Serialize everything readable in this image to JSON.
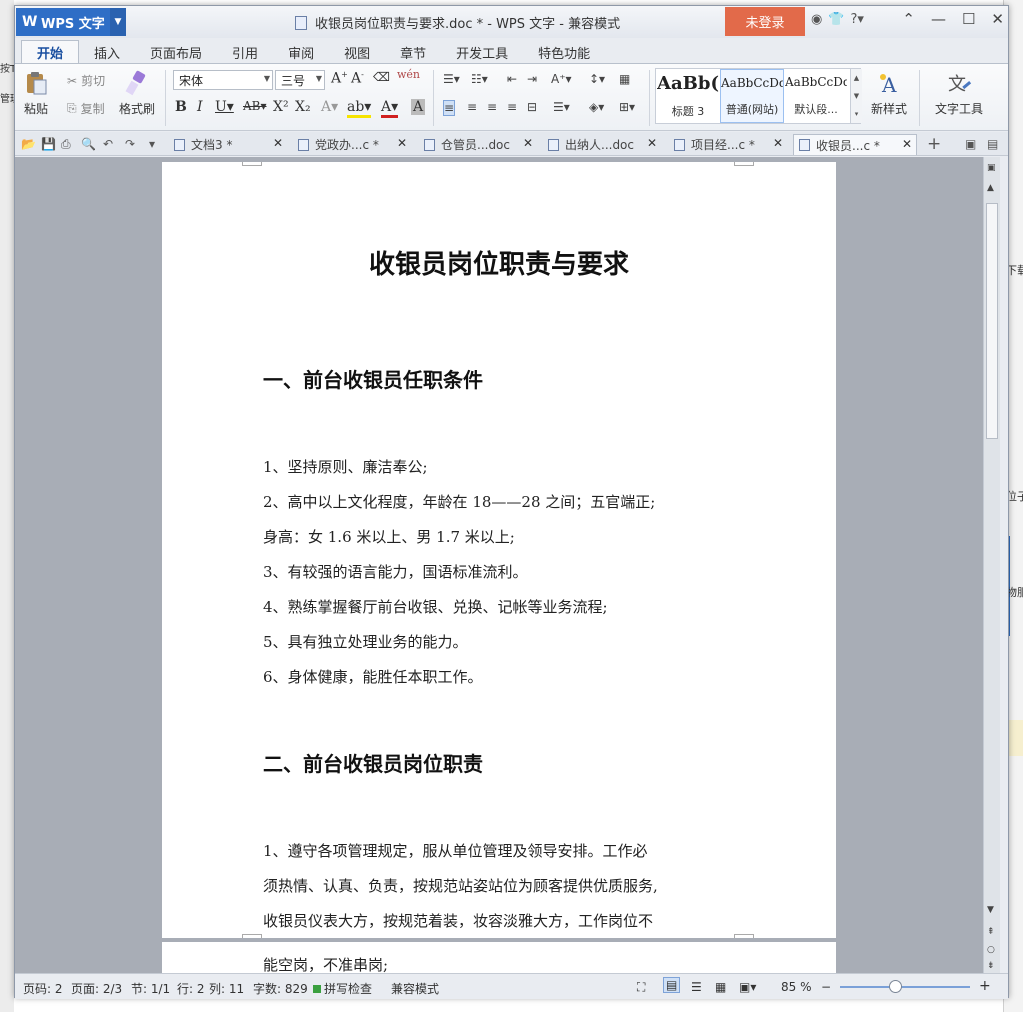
{
  "app": {
    "name": "WPS 文字",
    "window_title": "收银员岗位职责与要求.doc * - WPS 文字 - 兼容模式",
    "login_label": "未登录"
  },
  "ribbon_tabs": [
    "开始",
    "插入",
    "页面布局",
    "引用",
    "审阅",
    "视图",
    "章节",
    "开发工具",
    "特色功能"
  ],
  "ribbon": {
    "paste": "粘贴",
    "cut": "剪切",
    "copy": "复制",
    "format_painter": "格式刷",
    "font_name": "宋体",
    "font_size": "三号",
    "new_style": "新样式",
    "text_tools": "文字工具",
    "styles": [
      {
        "preview": "AaBb(",
        "name": "标题 3"
      },
      {
        "preview": "AaBbCcDd",
        "name": "普通(网站)"
      },
      {
        "preview": "AaBbCcDd",
        "name": "默认段..."
      }
    ]
  },
  "doc_tabs": [
    {
      "label": "文档3 *"
    },
    {
      "label": "党政办...c *"
    },
    {
      "label": "仓管员...doc"
    },
    {
      "label": "出纳人...doc"
    },
    {
      "label": "项目经...c *"
    },
    {
      "label": "收银员...c *"
    }
  ],
  "document": {
    "title": "收银员岗位职责与要求",
    "section1_heading": "一、前台收银员任职条件",
    "section1_items": [
      "1、坚持原则、廉洁奉公;",
      "2、高中以上文化程度，年龄在 18——28 之间；五官端正;",
      "身高：女 1.6 米以上、男 1.7 米以上;",
      "3、有较强的语言能力，国语标准流利。",
      "4、熟练掌握餐厅前台收银、兑换、记帐等业务流程;",
      "5、具有独立处理业务的能力。",
      "6、身体健康，能胜任本职工作。"
    ],
    "section2_heading": "二、前台收银员岗位职责",
    "section2_lines": [
      "1、遵守各项管理规定，服从单位管理及领导安排。工作必",
      "须热情、认真、负责，按规范站姿站位为顾客提供优质服务,",
      "收银员仪表大方，按规范着装，妆容淡雅大方，工作岗位不"
    ],
    "page2_line": "能空岗，不准串岗;"
  },
  "status": {
    "page": "页码: 2",
    "pages": "页面: 2/3",
    "section": "节: 1/1",
    "row": "行: 2",
    "col": "列: 11",
    "word_count": "字数: 829",
    "spell_check": "拼写检查",
    "compat": "兼容模式",
    "zoom": "85 %"
  },
  "desktop_right_texts": [
    "下载",
    "位子",
    "物服"
  ],
  "desktop_left_texts": [
    "按T",
    "管理"
  ]
}
